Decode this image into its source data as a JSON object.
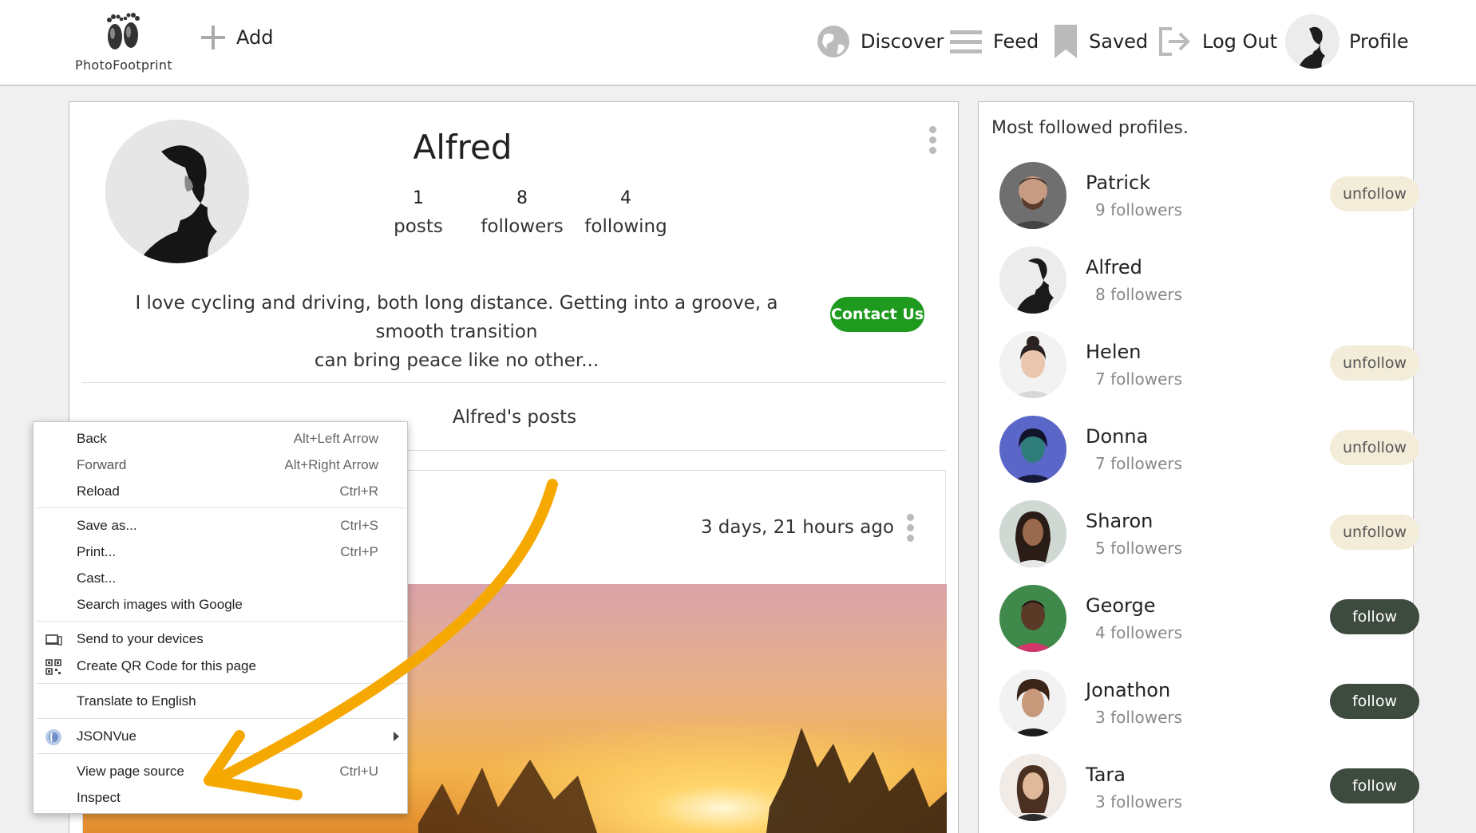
{
  "header": {
    "logo_text": "PhotoFootprint",
    "add_label": "Add",
    "nav": {
      "discover": "Discover",
      "feed": "Feed",
      "saved": "Saved",
      "logout": "Log Out",
      "profile": "Profile"
    }
  },
  "profile": {
    "name": "Alfred",
    "stats": [
      {
        "value": "1",
        "label": "posts"
      },
      {
        "value": "8",
        "label": "followers"
      },
      {
        "value": "4",
        "label": "following"
      }
    ],
    "bio_line1": "I love cycling and driving, both long distance. Getting into a groove, a smooth transition",
    "bio_line2": "can bring peace like no other...",
    "contact_label": "Contact Us",
    "posts_heading": "Alfred's posts",
    "post": {
      "time": "3 days, 21 hours ago"
    }
  },
  "sidebar": {
    "title": "Most followed profiles.",
    "profiles": [
      {
        "name": "Patrick",
        "followers": "9 followers",
        "button": "unfollow"
      },
      {
        "name": "Alfred",
        "followers": "8 followers",
        "button": ""
      },
      {
        "name": "Helen",
        "followers": "7 followers",
        "button": "unfollow"
      },
      {
        "name": "Donna",
        "followers": "7 followers",
        "button": "unfollow"
      },
      {
        "name": "Sharon",
        "followers": "5 followers",
        "button": "unfollow"
      },
      {
        "name": "George",
        "followers": "4 followers",
        "button": "follow"
      },
      {
        "name": "Jonathon",
        "followers": "3 followers",
        "button": "follow"
      },
      {
        "name": "Tara",
        "followers": "3 followers",
        "button": "follow"
      }
    ]
  },
  "context_menu": {
    "back": {
      "label": "Back",
      "shortcut": "Alt+Left Arrow"
    },
    "forward": {
      "label": "Forward",
      "shortcut": "Alt+Right Arrow"
    },
    "reload": {
      "label": "Reload",
      "shortcut": "Ctrl+R"
    },
    "save_as": {
      "label": "Save as...",
      "shortcut": "Ctrl+S"
    },
    "print": {
      "label": "Print...",
      "shortcut": "Ctrl+P"
    },
    "cast": {
      "label": "Cast..."
    },
    "search_images": {
      "label": "Search images with Google"
    },
    "send_devices": {
      "label": "Send to your devices"
    },
    "qr_code": {
      "label": "Create QR Code for this page"
    },
    "translate": {
      "label": "Translate to English"
    },
    "jsonvue": {
      "label": "JSONVue"
    },
    "view_source": {
      "label": "View page source",
      "shortcut": "Ctrl+U"
    },
    "inspect": {
      "label": "Inspect"
    }
  },
  "colors": {
    "contact_button": "#1e9a1e",
    "follow_button": "#3d4a3e",
    "unfollow_button": "#f3ecd9",
    "annotation_arrow": "#f5a800"
  }
}
